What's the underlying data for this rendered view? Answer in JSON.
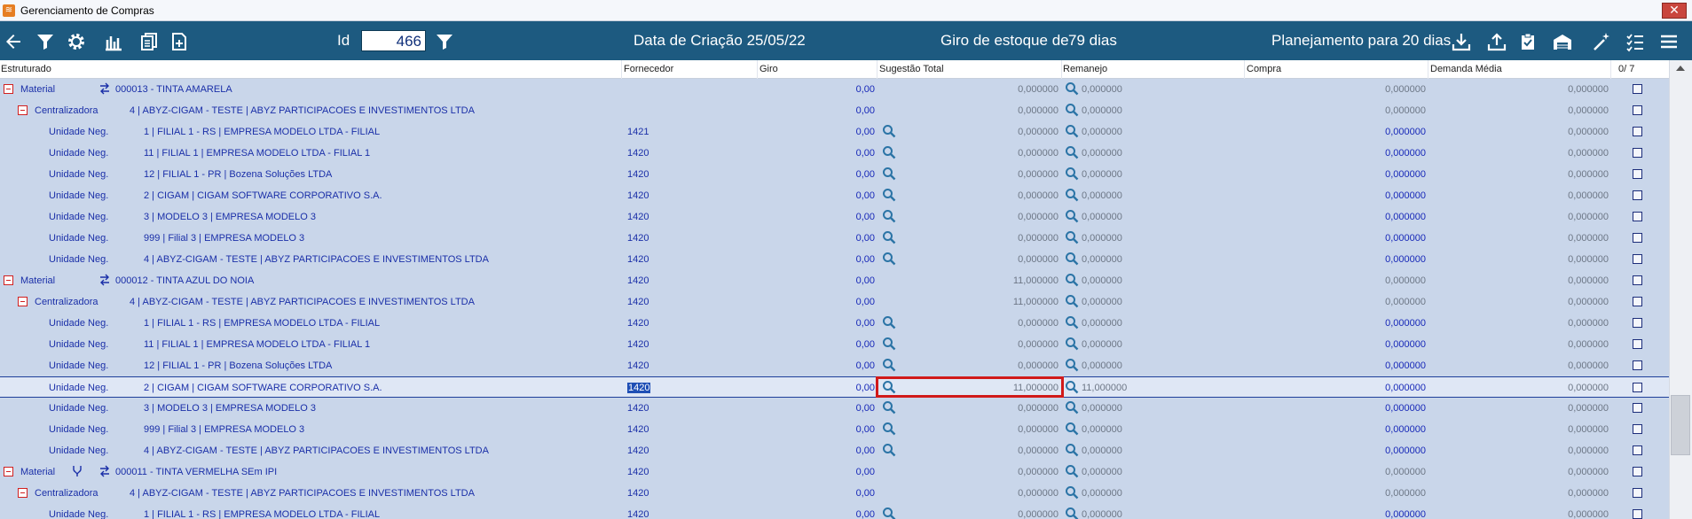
{
  "window": {
    "title": "Gerenciamento de Compras",
    "close_glyph": "✕"
  },
  "toolbar": {
    "id_label": "Id",
    "id_value": "466",
    "creation_date": "Data de Criação 25/05/22",
    "stock_turnover_label": "Giro de estoque de",
    "stock_turnover_value": "79 dias",
    "planning": "Planejamento para 20 dias"
  },
  "header": {
    "estruturado": "Estruturado",
    "fornecedor": "Fornecedor",
    "giro": "Giro",
    "sugestao_total": "Sugestão Total",
    "remanejo": "Remanejo",
    "compra": "Compra",
    "demanda_media": "Demanda Média",
    "selected_count": "0/ 7"
  },
  "rows": [
    {
      "type": "Material",
      "code": "000013 - TINTA AMARELA",
      "fornecedor": "",
      "giro": "0,00",
      "sug": "0,000000",
      "sug_icon": false,
      "rem": "0,000000",
      "compra": "0,000000",
      "dem": "0,000000"
    },
    {
      "type": "Centralizadora",
      "code": "4   | ABYZ-CIGAM - TESTE | ABYZ PARTICIPACOES E INVESTIMENTOS LTDA",
      "fornecedor": "",
      "giro": "0,00",
      "sug": "0,000000",
      "sug_icon": false,
      "rem": "0,000000",
      "compra": "0,000000",
      "dem": "0,000000"
    },
    {
      "type": "Unidade Neg.",
      "code": "1 | FILIAL 1 - RS | EMPRESA MODELO LTDA - FILIAL",
      "fornecedor": "1421",
      "giro": "0,00",
      "sug": "0,000000",
      "sug_icon": true,
      "rem": "0,000000",
      "compra": "0,000000",
      "dem": "0,000000"
    },
    {
      "type": "Unidade Neg.",
      "code": "11 | FILIAL 1 | EMPRESA MODELO LTDA - FILIAL 1",
      "fornecedor": "1420",
      "giro": "0,00",
      "sug": "0,000000",
      "sug_icon": true,
      "rem": "0,000000",
      "compra": "0,000000",
      "dem": "0,000000"
    },
    {
      "type": "Unidade Neg.",
      "code": "12 | FILIAL 1 - PR | Bozena Soluções LTDA",
      "fornecedor": "1420",
      "giro": "0,00",
      "sug": "0,000000",
      "sug_icon": true,
      "rem": "0,000000",
      "compra": "0,000000",
      "dem": "0,000000"
    },
    {
      "type": "Unidade Neg.",
      "code": "2 | CIGAM | CIGAM SOFTWARE CORPORATIVO S.A.",
      "fornecedor": "1420",
      "giro": "0,00",
      "sug": "0,000000",
      "sug_icon": true,
      "rem": "0,000000",
      "compra": "0,000000",
      "dem": "0,000000"
    },
    {
      "type": "Unidade Neg.",
      "code": "3 | MODELO 3 | EMPRESA MODELO 3",
      "fornecedor": "1420",
      "giro": "0,00",
      "sug": "0,000000",
      "sug_icon": true,
      "rem": "0,000000",
      "compra": "0,000000",
      "dem": "0,000000"
    },
    {
      "type": "Unidade Neg.",
      "code": "999 | Filial 3 | EMPRESA MODELO 3",
      "fornecedor": "1420",
      "giro": "0,00",
      "sug": "0,000000",
      "sug_icon": true,
      "rem": "0,000000",
      "compra": "0,000000",
      "dem": "0,000000"
    },
    {
      "type": "Unidade Neg.",
      "code": "4 | ABYZ-CIGAM - TESTE | ABYZ PARTICIPACOES E INVESTIMENTOS LTDA",
      "fornecedor": "1420",
      "giro": "0,00",
      "sug": "0,000000",
      "sug_icon": true,
      "rem": "0,000000",
      "compra": "0,000000",
      "dem": "0,000000"
    },
    {
      "type": "Material",
      "code": "000012 - TINTA AZUL DO NOIA",
      "fornecedor": "1420",
      "giro": "0,00",
      "sug": "11,000000",
      "sug_icon": false,
      "rem": "0,000000",
      "compra": "0,000000",
      "dem": "0,000000"
    },
    {
      "type": "Centralizadora",
      "code": "4   | ABYZ-CIGAM - TESTE | ABYZ PARTICIPACOES E INVESTIMENTOS LTDA",
      "fornecedor": "1420",
      "giro": "0,00",
      "sug": "11,000000",
      "sug_icon": false,
      "rem": "0,000000",
      "compra": "0,000000",
      "dem": "0,000000"
    },
    {
      "type": "Unidade Neg.",
      "code": "1 | FILIAL 1 - RS | EMPRESA MODELO LTDA - FILIAL",
      "fornecedor": "1420",
      "giro": "0,00",
      "sug": "0,000000",
      "sug_icon": true,
      "rem": "0,000000",
      "compra": "0,000000",
      "dem": "0,000000"
    },
    {
      "type": "Unidade Neg.",
      "code": "11 | FILIAL 1 | EMPRESA MODELO LTDA - FILIAL 1",
      "fornecedor": "1420",
      "giro": "0,00",
      "sug": "0,000000",
      "sug_icon": true,
      "rem": "0,000000",
      "compra": "0,000000",
      "dem": "0,000000"
    },
    {
      "type": "Unidade Neg.",
      "code": "12 | FILIAL 1 - PR | Bozena Soluções LTDA",
      "fornecedor": "1420",
      "giro": "0,00",
      "sug": "0,000000",
      "sug_icon": true,
      "rem": "0,000000",
      "compra": "0,000000",
      "dem": "0,000000"
    },
    {
      "type": "Unidade Neg.",
      "code": "2 | CIGAM | CIGAM SOFTWARE CORPORATIVO S.A.",
      "fornecedor": "1420",
      "giro": "0,00",
      "sug": "11,000000",
      "sug_icon": true,
      "rem": "11,000000",
      "compra": "0,000000",
      "dem": "0,000000",
      "selected": true
    },
    {
      "type": "Unidade Neg.",
      "code": "3 | MODELO 3 | EMPRESA MODELO 3",
      "fornecedor": "1420",
      "giro": "0,00",
      "sug": "0,000000",
      "sug_icon": true,
      "rem": "0,000000",
      "compra": "0,000000",
      "dem": "0,000000"
    },
    {
      "type": "Unidade Neg.",
      "code": "999 | Filial 3 | EMPRESA MODELO 3",
      "fornecedor": "1420",
      "giro": "0,00",
      "sug": "0,000000",
      "sug_icon": true,
      "rem": "0,000000",
      "compra": "0,000000",
      "dem": "0,000000"
    },
    {
      "type": "Unidade Neg.",
      "code": "4 | ABYZ-CIGAM - TESTE | ABYZ PARTICIPACOES E INVESTIMENTOS LTDA",
      "fornecedor": "1420",
      "giro": "0,00",
      "sug": "0,000000",
      "sug_icon": true,
      "rem": "0,000000",
      "compra": "0,000000",
      "dem": "0,000000"
    },
    {
      "type": "Material",
      "code": "000011 - TINTA VERMELHA SEm IPI",
      "fornecedor": "1420",
      "giro": "0,00",
      "sug": "0,000000",
      "sug_icon": false,
      "rem": "0,000000",
      "compra": "0,000000",
      "dem": "0,000000",
      "branch": true
    },
    {
      "type": "Centralizadora",
      "code": "4   | ABYZ-CIGAM - TESTE | ABYZ PARTICIPACOES E INVESTIMENTOS LTDA",
      "fornecedor": "1420",
      "giro": "0,00",
      "sug": "0,000000",
      "sug_icon": false,
      "rem": "0,000000",
      "compra": "0,000000",
      "dem": "0,000000"
    },
    {
      "type": "Unidade Neg.",
      "code": "1 | FILIAL 1 - RS | EMPRESA MODELO LTDA - FILIAL",
      "fornecedor": "1420",
      "giro": "0,00",
      "sug": "0,000000",
      "sug_icon": true,
      "rem": "0,000000",
      "compra": "0,000000",
      "dem": "0,000000"
    }
  ]
}
